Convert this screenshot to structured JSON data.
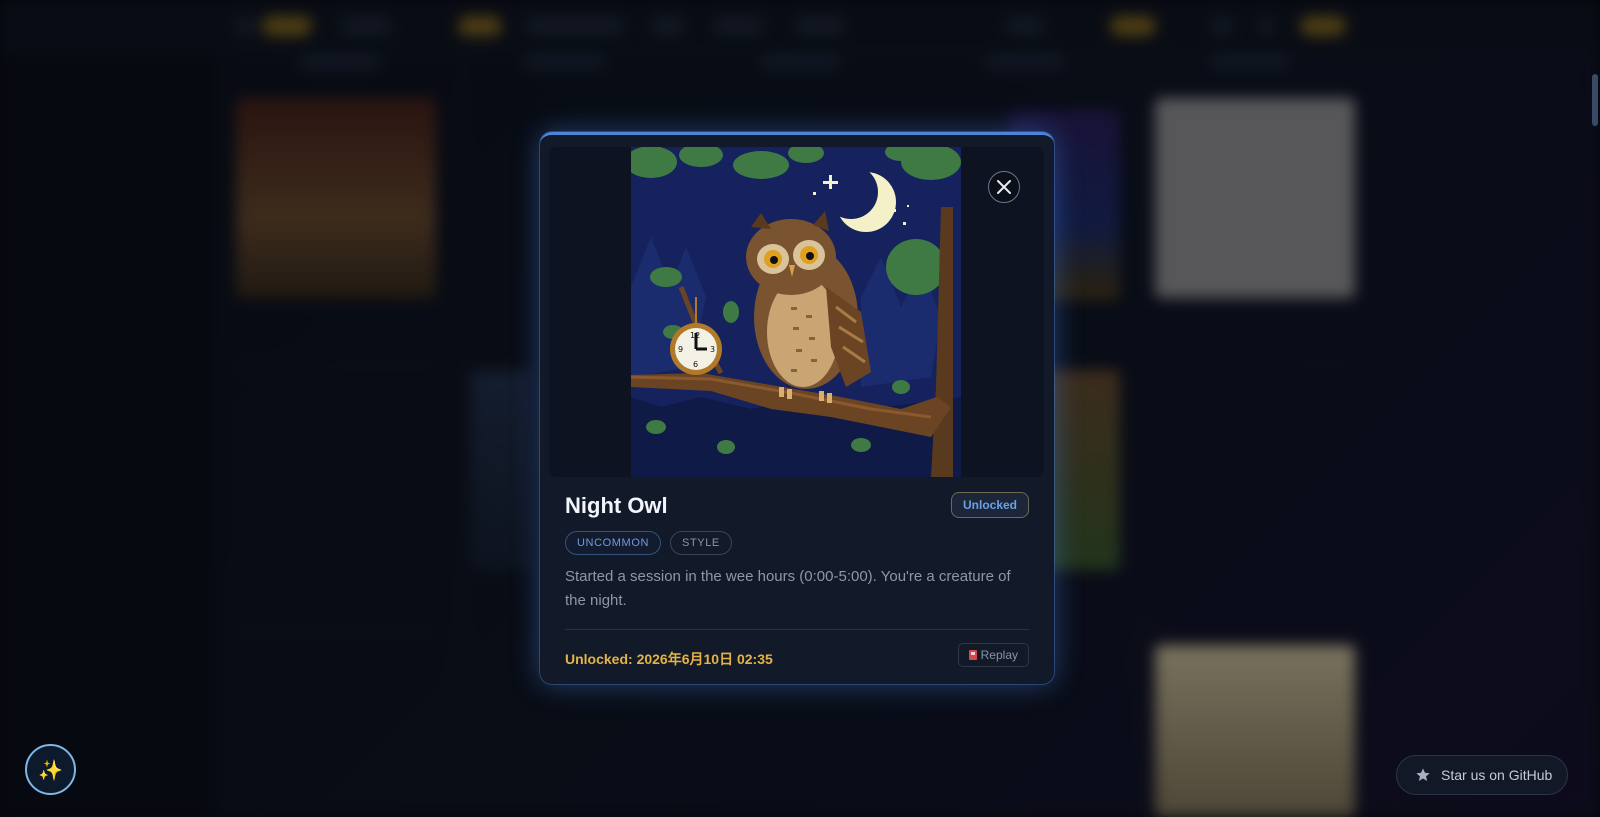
{
  "modal": {
    "title": "Night Owl",
    "status": "Unlocked",
    "rarity_tag": "UNCOMMON",
    "category_tag": "STYLE",
    "description": "Started a session in the wee hours (0:00-5:00). You're a creature of the night.",
    "unlocked_text": "Unlocked: 2026年6月10日 02:35",
    "replay_label": "Replay",
    "image_icon": "night-owl-pixel-art",
    "close_icon": "close-icon"
  },
  "floating": {
    "github_label": "Star us on GitHub",
    "github_icon": "star-icon",
    "fab_icon": "sparkles-icon",
    "fab_glyph": "✨"
  },
  "colors": {
    "accent": "#4b84d9",
    "unlock_time": "#e3b445",
    "rarity": "#6d9be0",
    "modal_bg": "#121a29"
  }
}
